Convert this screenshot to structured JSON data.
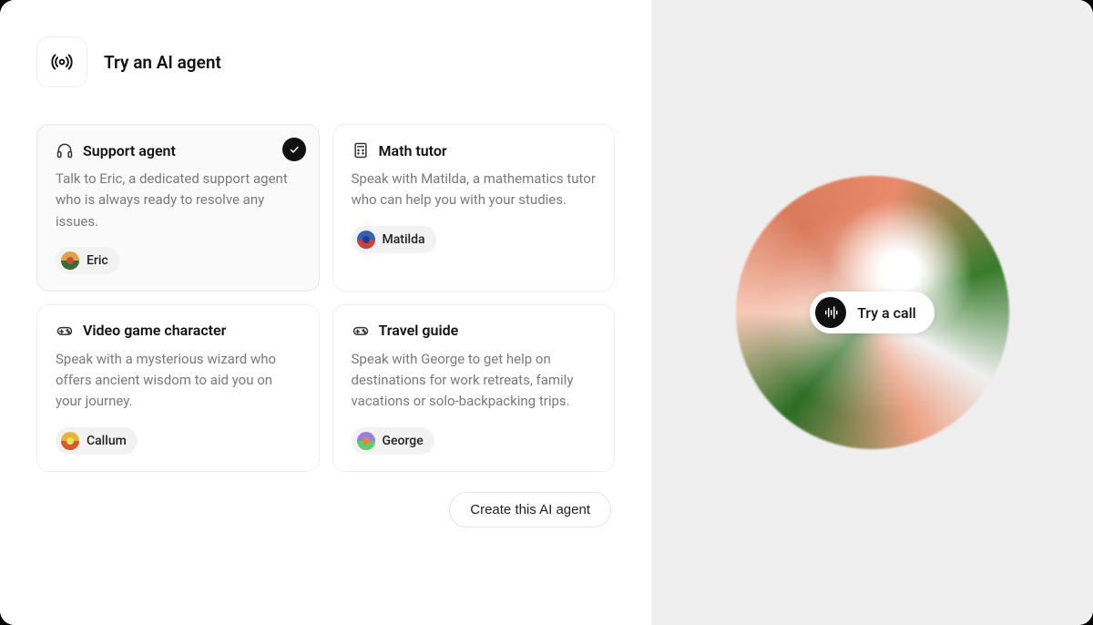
{
  "header": {
    "title": "Try an AI agent",
    "icon": "broadcast-icon"
  },
  "agents": [
    {
      "id": "support",
      "title": "Support agent",
      "description": "Talk to Eric, a dedicated support agent who is always ready to resolve any issues.",
      "persona": "Eric",
      "icon": "headphones-icon",
      "selected": true,
      "avatar_colors": [
        "#e0a24d",
        "#3c6b3a",
        "#c94f3b"
      ]
    },
    {
      "id": "math",
      "title": "Math tutor",
      "description": "Speak with Matilda, a mathematics tutor who can help you with your studies.",
      "persona": "Matilda",
      "icon": "calculator-icon",
      "selected": false,
      "avatar_colors": [
        "#2f63b5",
        "#c9443a",
        "#2b3a8f"
      ]
    },
    {
      "id": "wizard",
      "title": "Video game character",
      "description": "Speak with a mysterious wizard who offers ancient wisdom to aid you on your journey.",
      "persona": "Callum",
      "icon": "gamepad-icon",
      "selected": false,
      "avatar_colors": [
        "#e6b43c",
        "#d25a2e",
        "#efe06a"
      ]
    },
    {
      "id": "travel",
      "title": "Travel guide",
      "description": "Speak with George to get help on destinations for work retreats, family vacations or solo-backpacking trips.",
      "persona": "George",
      "icon": "gamepad-icon",
      "selected": false,
      "avatar_colors": [
        "#9a7de0",
        "#67c96f",
        "#e0884a"
      ]
    }
  ],
  "cta": {
    "create_label": "Create this AI agent"
  },
  "call": {
    "label": "Try a call"
  }
}
